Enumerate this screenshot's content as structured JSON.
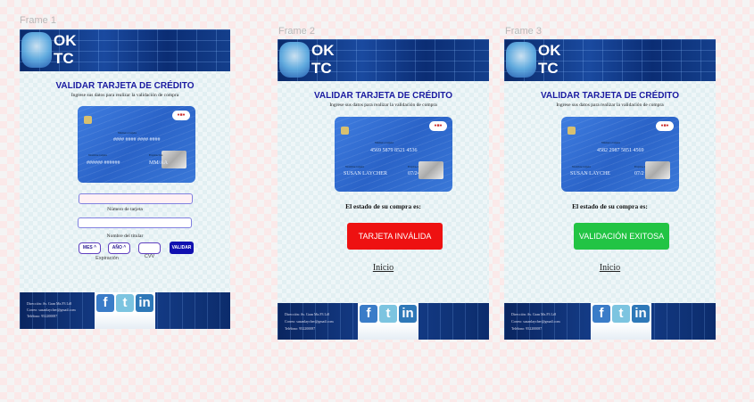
{
  "frames": [
    {
      "label": "Frame 1",
      "logo": "OK\nTC",
      "title": "VALIDAR TARJETA DE CRÉDITO",
      "subtitle": "Ingrese sus datos para realizar la validación de compra",
      "card": {
        "number_label": "Número tarjeta",
        "number": "#### #### #### ####",
        "name_label": "Nombre tarjeta",
        "name": "###### ######",
        "exp_label": "Expiración",
        "exp": "MM/AA"
      },
      "form": {
        "card_number_label": "Número de tarjeta",
        "card_number_value": "",
        "holder_label": "Nombre del titular",
        "holder_value": "",
        "month": "MES ^",
        "year": "AÑO ^",
        "expiration_label": "Expiración",
        "cvv_label": "CVV",
        "cvv_value": "",
        "submit": "VALIDAR"
      },
      "footer": {
        "address": "Dirección: Av. Gran Mz.F3 Lt8",
        "email": "Correo: susanlaycher@gmail.com",
        "phone": "Teléfono: 952200087"
      }
    },
    {
      "label": "Frame 2",
      "logo": "OK\nTC",
      "title": "VALIDAR TARJETA DE CRÉDITO",
      "subtitle": "Ingrese sus datos para realizar la validación de compra",
      "card": {
        "number_label": "Número tarjeta",
        "number": "4569 5879 8521 4536",
        "name_label": "Nombre tarjeta",
        "name": "SUSAN LAYCHER",
        "exp_label": "Expiración",
        "exp": "07/24"
      },
      "status_label": "El estado de su compra es:",
      "status": "TARJETA INVÁLIDA",
      "status_color": "#ee1111",
      "home_link": "Inicio",
      "footer": {
        "address": "Dirección: Av. Gran Mz.F3 Lt8",
        "email": "Correo: susanlaycher@gmail.com",
        "phone": "Teléfono: 952200087"
      }
    },
    {
      "label": "Frame 3",
      "logo": "OK\nTC",
      "title": "VALIDAR TARJETA DE CRÉDITO",
      "subtitle": "Ingrese sus datos para realizar la validación de compra",
      "card": {
        "number_label": "Número tarjeta",
        "number": "4582 2987 5851 4569",
        "name_label": "Nombre tarjeta",
        "name": "SUSAN LAYCHE",
        "exp_label": "Expiración",
        "exp": "07/2"
      },
      "status_label": "El estado de su compra es:",
      "status": "VALIDACIÓN EXITOSA",
      "status_color": "#22c444",
      "home_link": "Inicio",
      "footer": {
        "address": "Dirección: Av. Gran Mz.F3 Lt8",
        "email": "Correo: susanlaycher@gmail.com",
        "phone": "Teléfono: 952200087"
      }
    }
  ],
  "social": {
    "facebook": "f",
    "twitter": "t",
    "linkedin": "in"
  },
  "colors": {
    "title": "#1a1aa0",
    "validar": "#1010b0"
  }
}
